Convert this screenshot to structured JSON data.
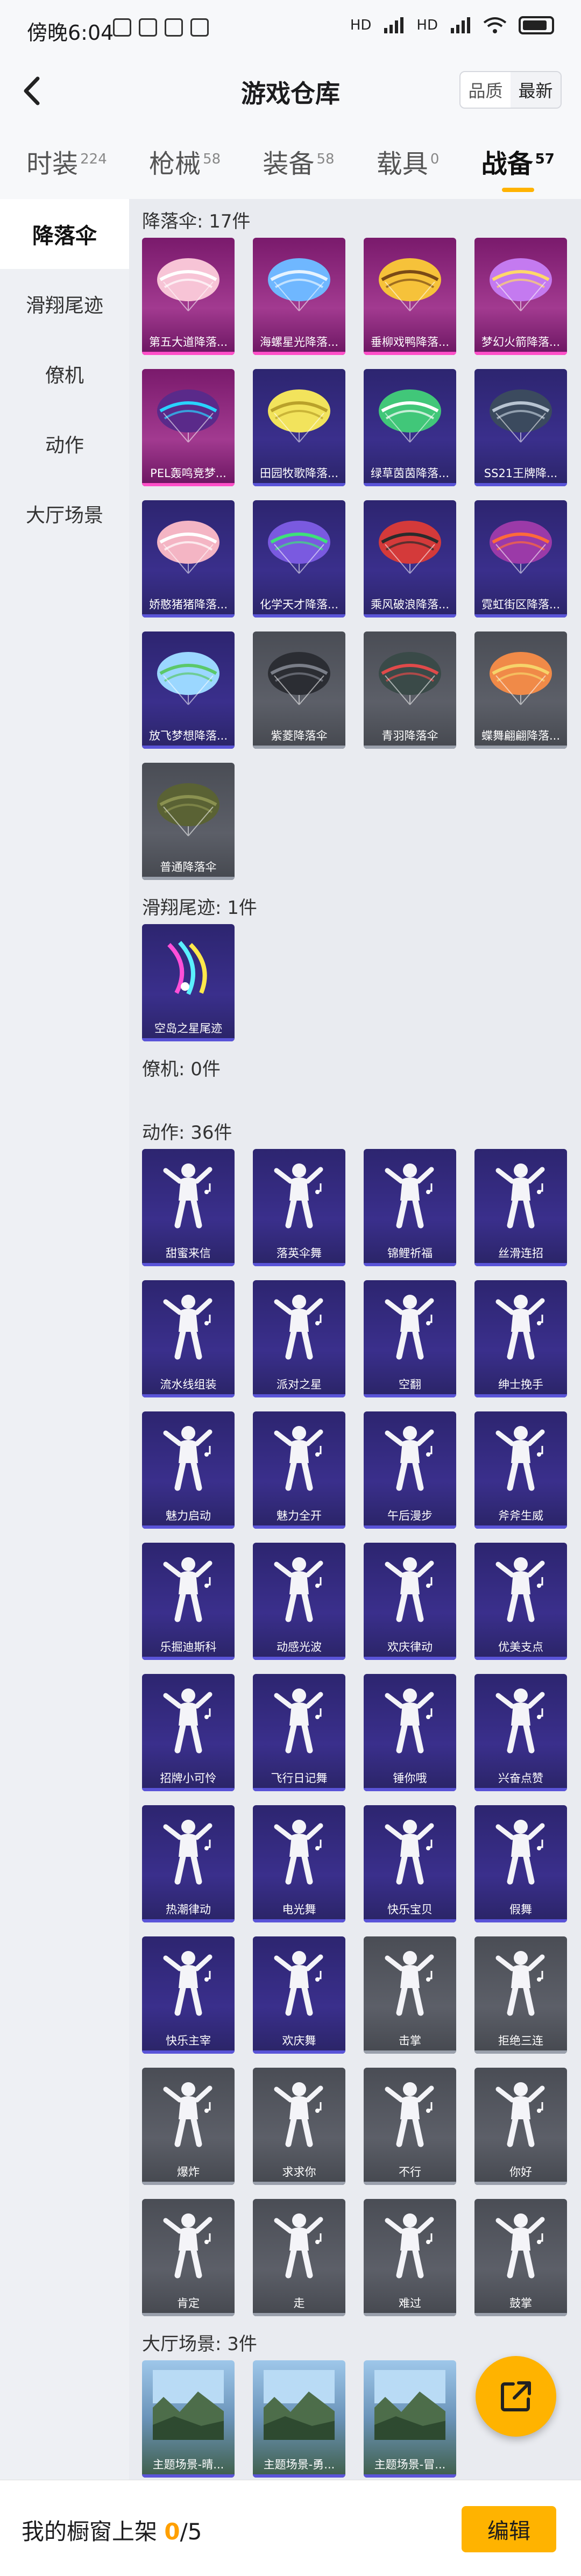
{
  "status_bar": {
    "time": "傍晚6:04",
    "net_label": "HD"
  },
  "header": {
    "title": "游戏仓库",
    "sort_options": [
      "品质",
      "最新"
    ],
    "sort_selected": "最新"
  },
  "tabs": [
    {
      "label": "时装",
      "count": "224"
    },
    {
      "label": "枪械",
      "count": "58"
    },
    {
      "label": "装备",
      "count": "58"
    },
    {
      "label": "载具",
      "count": "0"
    },
    {
      "label": "战备",
      "count": "57",
      "active": true
    }
  ],
  "sidebar": [
    {
      "label": "降落伞",
      "active": true
    },
    {
      "label": "滑翔尾迹"
    },
    {
      "label": "僚机"
    },
    {
      "label": "动作"
    },
    {
      "label": "大厅场景"
    }
  ],
  "sections": [
    {
      "title": "降落伞: 17件",
      "items": [
        {
          "label": "第五大道降落...",
          "rarity": "pink",
          "art": "chute-pink"
        },
        {
          "label": "海螺星光降落...",
          "rarity": "pink",
          "art": "chute-blue"
        },
        {
          "label": "垂柳戏鸭降落...",
          "rarity": "pink",
          "art": "chute-yellow"
        },
        {
          "label": "梦幻火箭降落...",
          "rarity": "pink",
          "art": "chute-purple"
        },
        {
          "label": "PEL轰鸣竞梦...",
          "rarity": "pink",
          "art": "chute-dark"
        },
        {
          "label": "田园牧歌降落...",
          "rarity": "purple",
          "art": "chute-lemon"
        },
        {
          "label": "绿草茵茵降落...",
          "rarity": "purple",
          "art": "chute-green"
        },
        {
          "label": "SS21王牌降...",
          "rarity": "purple",
          "art": "chute-ss"
        },
        {
          "label": "娇憨猪猪降落...",
          "rarity": "purple",
          "art": "chute-pig"
        },
        {
          "label": "化学天才降落...",
          "rarity": "purple",
          "art": "chute-stripe"
        },
        {
          "label": "乘风破浪降落...",
          "rarity": "purple",
          "art": "chute-red"
        },
        {
          "label": "霓虹街区降落...",
          "rarity": "purple",
          "art": "chute-neon"
        },
        {
          "label": "放飞梦想降落...",
          "rarity": "purple",
          "art": "chute-sky"
        },
        {
          "label": "紫菱降落伞",
          "rarity": "gray",
          "art": "chute-gray"
        },
        {
          "label": "青羽降落伞",
          "rarity": "gray",
          "art": "chute-teal"
        },
        {
          "label": "蝶舞翩翩降落...",
          "rarity": "gray",
          "art": "chute-orange"
        },
        {
          "label": "普通降落伞",
          "rarity": "gray",
          "art": "chute-olive"
        }
      ]
    },
    {
      "title": "滑翔尾迹: 1件",
      "items": [
        {
          "label": "空岛之星尾迹",
          "rarity": "purple",
          "art": "trail"
        }
      ]
    },
    {
      "title": "僚机: 0件",
      "items": []
    },
    {
      "title": "动作: 36件",
      "items": [
        {
          "label": "甜蜜来信",
          "rarity": "purple",
          "art": "pose"
        },
        {
          "label": "落英伞舞",
          "rarity": "purple",
          "art": "pose"
        },
        {
          "label": "锦鲤祈福",
          "rarity": "purple",
          "art": "pose"
        },
        {
          "label": "丝滑连招",
          "rarity": "purple",
          "art": "pose"
        },
        {
          "label": "流水线组装",
          "rarity": "purple",
          "art": "pose"
        },
        {
          "label": "派对之星",
          "rarity": "purple",
          "art": "pose"
        },
        {
          "label": "空翻",
          "rarity": "purple",
          "art": "pose"
        },
        {
          "label": "绅士挽手",
          "rarity": "purple",
          "art": "pose"
        },
        {
          "label": "魅力启动",
          "rarity": "purple",
          "art": "pose"
        },
        {
          "label": "魅力全开",
          "rarity": "purple",
          "art": "pose"
        },
        {
          "label": "午后漫步",
          "rarity": "purple",
          "art": "pose"
        },
        {
          "label": "斧斧生威",
          "rarity": "purple",
          "art": "pose"
        },
        {
          "label": "乐掘迪斯科",
          "rarity": "purple",
          "art": "pose"
        },
        {
          "label": "动感光波",
          "rarity": "purple",
          "art": "pose"
        },
        {
          "label": "欢庆律动",
          "rarity": "purple",
          "art": "pose"
        },
        {
          "label": "优美支点",
          "rarity": "purple",
          "art": "pose"
        },
        {
          "label": "招牌小可怜",
          "rarity": "purple",
          "art": "pose"
        },
        {
          "label": "飞行日记舞",
          "rarity": "purple",
          "art": "pose"
        },
        {
          "label": "锤你哦",
          "rarity": "purple",
          "art": "pose"
        },
        {
          "label": "兴奋点赞",
          "rarity": "purple",
          "art": "pose"
        },
        {
          "label": "热潮律动",
          "rarity": "purple",
          "art": "pose"
        },
        {
          "label": "电光舞",
          "rarity": "purple",
          "art": "pose"
        },
        {
          "label": "快乐宝贝",
          "rarity": "purple",
          "art": "pose"
        },
        {
          "label": "假舞",
          "rarity": "purple",
          "art": "pose"
        },
        {
          "label": "快乐主宰",
          "rarity": "purple",
          "art": "pose"
        },
        {
          "label": "欢庆舞",
          "rarity": "purple",
          "art": "pose"
        },
        {
          "label": "击掌",
          "rarity": "gray",
          "art": "pose"
        },
        {
          "label": "拒绝三连",
          "rarity": "gray",
          "art": "pose"
        },
        {
          "label": "爆炸",
          "rarity": "gray",
          "art": "pose"
        },
        {
          "label": "求求你",
          "rarity": "gray",
          "art": "pose"
        },
        {
          "label": "不行",
          "rarity": "gray",
          "art": "pose"
        },
        {
          "label": "你好",
          "rarity": "gray",
          "art": "pose"
        },
        {
          "label": "肯定",
          "rarity": "gray",
          "art": "pose"
        },
        {
          "label": "走",
          "rarity": "gray",
          "art": "pose"
        },
        {
          "label": "难过",
          "rarity": "gray",
          "art": "pose"
        },
        {
          "label": "鼓掌",
          "rarity": "gray",
          "art": "pose"
        }
      ]
    },
    {
      "title": "大厅场景: 3件",
      "items": [
        {
          "label": "主题场景-晴...",
          "rarity": "scene",
          "art": "scene"
        },
        {
          "label": "主题场景-勇...",
          "rarity": "scene",
          "art": "scene"
        },
        {
          "label": "主题场景-冒...",
          "rarity": "scene",
          "art": "scene"
        }
      ]
    }
  ],
  "bottom": {
    "label": "我的橱窗上架 ",
    "count": "0",
    "total": "/5",
    "edit_label": "编辑"
  },
  "colors": {
    "accent": "#ffb300",
    "pink_rarity": "#a23a90",
    "purple_rarity": "#3a2f8c",
    "gray_rarity": "#5c5f68"
  }
}
